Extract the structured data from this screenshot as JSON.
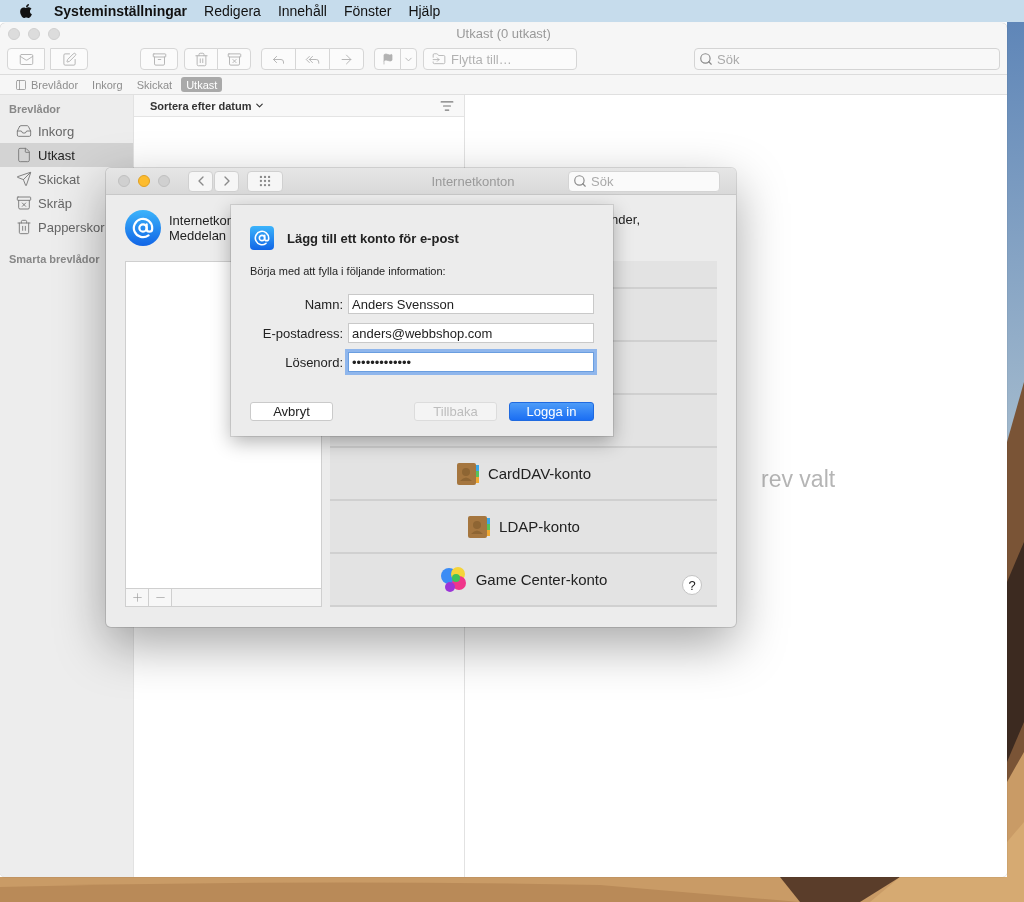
{
  "menu_bar": {
    "items": [
      {
        "label": "Systeminställningar",
        "kind": "app"
      },
      {
        "label": "Redigera",
        "kind": "menu"
      },
      {
        "label": "Innehåll",
        "kind": "menu"
      },
      {
        "label": "Fönster",
        "kind": "menu"
      },
      {
        "label": "Hjälp",
        "kind": "menu"
      }
    ]
  },
  "mail_window": {
    "title": "Utkast (0 utkast)",
    "toolbar": {
      "move_button": "Flytta till…",
      "search": {
        "placeholder": "Sök"
      }
    },
    "favorites": [
      {
        "label": "Brevlådor",
        "kind": "toggle",
        "selected": false
      },
      {
        "label": "Inkorg",
        "kind": "mailbox",
        "selected": false
      },
      {
        "label": "Skickat",
        "kind": "mailbox",
        "selected": false
      },
      {
        "label": "Utkast",
        "kind": "mailbox",
        "selected": true
      }
    ],
    "sidebar": {
      "heading": "Brevlådor",
      "items": [
        {
          "label": "Inkorg",
          "kind": "inbox",
          "selected": false
        },
        {
          "label": "Utkast",
          "kind": "drafts",
          "selected": true
        },
        {
          "label": "Skickat",
          "kind": "sent",
          "selected": false
        },
        {
          "label": "Skräp",
          "kind": "junk",
          "selected": false
        },
        {
          "label": "Papperskor",
          "kind": "trash",
          "selected": false
        }
      ],
      "smart_heading": "Smarta brevlådor"
    },
    "list_header": {
      "sort_label": "Sortera efter datum"
    },
    "preview_text": "rev valt"
  },
  "prefs_window": {
    "title": "Internetkonton",
    "search": {
      "placeholder": "Sök"
    },
    "description": {
      "line_1": "Internetkon",
      "line_2": "Meddelan",
      "right_fragment": "nder,"
    },
    "accounts": [
      {
        "label": "CardDAV-konto",
        "kind": "carddav"
      },
      {
        "label": "LDAP-konto",
        "kind": "ldap"
      },
      {
        "label": "Game Center-konto",
        "kind": "gamecenter"
      }
    ],
    "help_button": "?"
  },
  "sheet": {
    "title": "Lägg till ett konto för e-post",
    "intro": "Börja med att fylla i följande information:",
    "fields": [
      {
        "label": "Namn:",
        "value": "Anders Svensson",
        "focused": false
      },
      {
        "label": "E-postadress:",
        "value": "anders@webbshop.com",
        "focused": false
      },
      {
        "label": "Lösenord:",
        "value": "•••••••••••••",
        "focused": true
      }
    ],
    "buttons": [
      {
        "label": "Avbryt",
        "kind": "normal",
        "disabled": false
      },
      {
        "label": "Tillbaka",
        "kind": "normal",
        "disabled": true
      },
      {
        "label": "Logga in",
        "kind": "default",
        "disabled": false
      }
    ]
  }
}
